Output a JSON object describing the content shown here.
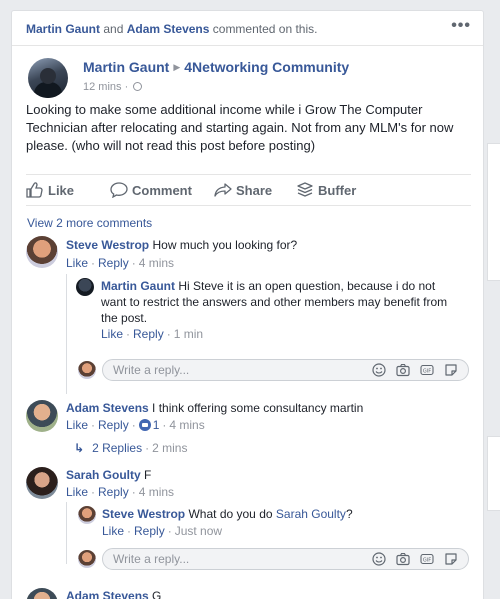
{
  "story": {
    "actor_1": "Martin Gaunt",
    "conjunction": "and",
    "actor_2": "Adam Stevens",
    "action_text": "commented on this.",
    "more_icon": "more-options-icon"
  },
  "post": {
    "author": "Martin Gaunt",
    "group": "4Networking Community",
    "time": "12 mins",
    "privacy_icon": "globe-icon",
    "body": "Looking to make some additional income while i Grow The Computer Technician after relocating and starting again. Not from any MLM's for now please. (who will not read this post before posting)"
  },
  "actions": {
    "like": "Like",
    "comment": "Comment",
    "share": "Share",
    "buffer": "Buffer"
  },
  "comments": {
    "view_more": "View 2 more comments",
    "c1": {
      "name": "Steve Westrop",
      "text": "How much you looking for?",
      "like": "Like",
      "reply": "Reply",
      "time": "4 mins"
    },
    "c1_r1": {
      "name": "Martin Gaunt",
      "text_line1": "Hi Steve it is an open question, because i do not",
      "text_line2": "want to restrict the answers and other members may benefit from",
      "text_line3": "the post.",
      "like": "Like",
      "reply": "Reply",
      "time": "1 min"
    },
    "reply_placeholder": "Write a reply...",
    "c2": {
      "name": "Adam Stevens",
      "text": "I think offering some consultancy martin",
      "like": "Like",
      "reply": "Reply",
      "reactions": "1",
      "time": "4 mins",
      "replies_link": "2 Replies",
      "replies_time": "2 mins"
    },
    "c3": {
      "name": "Sarah Goulty",
      "text": "F",
      "like": "Like",
      "reply": "Reply",
      "time": "4 mins"
    },
    "c3_r1": {
      "name": "Steve Westrop",
      "text": "What do you do",
      "mention": "Sarah Goulty",
      "suffix": "?",
      "like": "Like",
      "reply": "Reply",
      "time": "Just now"
    },
    "c4": {
      "name": "Adam Stevens",
      "text": "G"
    }
  },
  "colors": {
    "link": "#385898",
    "muted": "#90949c",
    "background": "#e9ebee",
    "like_badge": "#4267b2"
  }
}
